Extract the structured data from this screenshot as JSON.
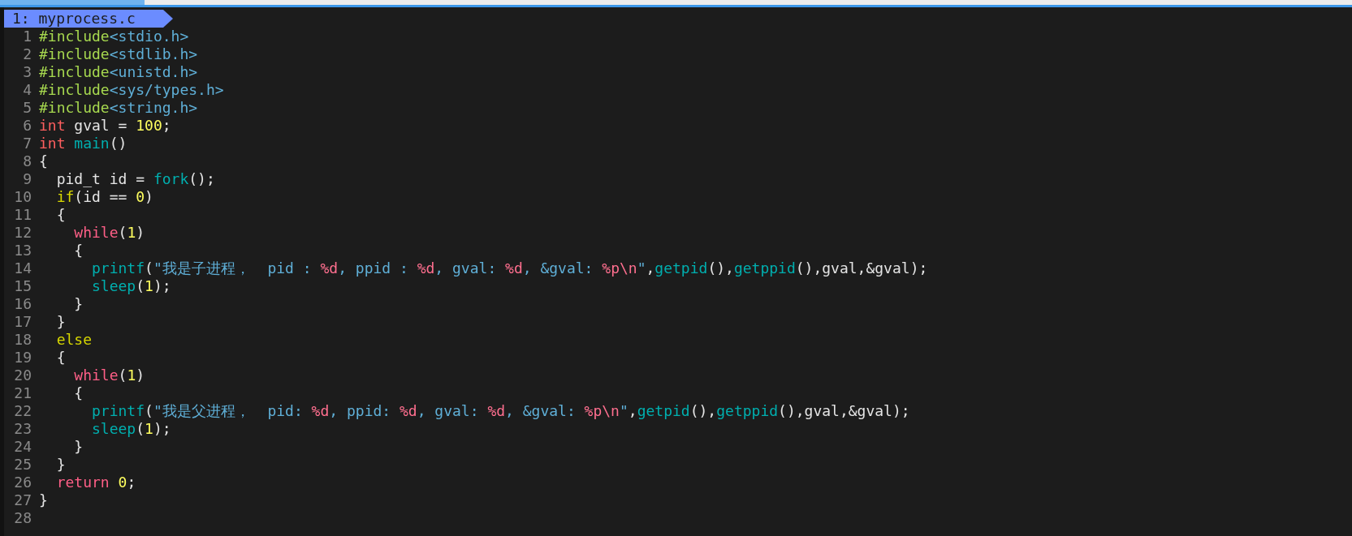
{
  "tab": {
    "label": "1: myprocess.c",
    "selected": true
  },
  "lines": [
    {
      "number": "1",
      "tokens": [
        {
          "kind": "preproc",
          "text": "#include"
        },
        {
          "kind": "path",
          "text": "<stdio.h>"
        }
      ]
    },
    {
      "number": "2",
      "tokens": [
        {
          "kind": "preproc",
          "text": "#include"
        },
        {
          "kind": "path",
          "text": "<stdlib.h>"
        }
      ]
    },
    {
      "number": "3",
      "tokens": [
        {
          "kind": "preproc",
          "text": "#include"
        },
        {
          "kind": "path",
          "text": "<unistd.h>"
        }
      ]
    },
    {
      "number": "4",
      "tokens": [
        {
          "kind": "preproc",
          "text": "#include"
        },
        {
          "kind": "path",
          "text": "<sys/types.h>"
        }
      ]
    },
    {
      "number": "5",
      "tokens": [
        {
          "kind": "preproc",
          "text": "#include"
        },
        {
          "kind": "path",
          "text": "<string.h>"
        }
      ]
    },
    {
      "number": "6",
      "tokens": [
        {
          "kind": "type",
          "text": "int"
        },
        {
          "kind": "plain",
          "text": " gval = "
        },
        {
          "kind": "number",
          "text": "100"
        },
        {
          "kind": "plain",
          "text": ";"
        }
      ]
    },
    {
      "number": "7",
      "tokens": [
        {
          "kind": "type",
          "text": "int "
        },
        {
          "kind": "func",
          "text": "main"
        },
        {
          "kind": "plain",
          "text": "()"
        }
      ]
    },
    {
      "number": "8",
      "tokens": [
        {
          "kind": "plain",
          "text": "{"
        }
      ]
    },
    {
      "number": "9",
      "tokens": [
        {
          "kind": "plain",
          "text": "  pid_t id = "
        },
        {
          "kind": "func",
          "text": "fork"
        },
        {
          "kind": "plain",
          "text": "();"
        }
      ]
    },
    {
      "number": "10",
      "tokens": [
        {
          "kind": "cond",
          "text": "  if"
        },
        {
          "kind": "plain",
          "text": "(id == "
        },
        {
          "kind": "number",
          "text": "0"
        },
        {
          "kind": "plain",
          "text": ")"
        }
      ]
    },
    {
      "number": "11",
      "tokens": [
        {
          "kind": "plain",
          "text": "  {"
        }
      ]
    },
    {
      "number": "12",
      "tokens": [
        {
          "kind": "keyword",
          "text": "    while"
        },
        {
          "kind": "plain",
          "text": "("
        },
        {
          "kind": "number",
          "text": "1"
        },
        {
          "kind": "plain",
          "text": ")"
        }
      ]
    },
    {
      "number": "13",
      "tokens": [
        {
          "kind": "plain",
          "text": "    {"
        }
      ]
    },
    {
      "number": "14",
      "tokens": [
        {
          "kind": "func",
          "text": "      printf"
        },
        {
          "kind": "plain",
          "text": "("
        },
        {
          "kind": "string",
          "text": "\"我是子进程，  pid : "
        },
        {
          "kind": "format",
          "text": "%d"
        },
        {
          "kind": "string",
          "text": ", ppid : "
        },
        {
          "kind": "format",
          "text": "%d"
        },
        {
          "kind": "string",
          "text": ", gval: "
        },
        {
          "kind": "format",
          "text": "%d"
        },
        {
          "kind": "string",
          "text": ", &gval: "
        },
        {
          "kind": "format",
          "text": "%p\\n"
        },
        {
          "kind": "string",
          "text": "\""
        },
        {
          "kind": "plain",
          "text": ","
        },
        {
          "kind": "func",
          "text": "getpid"
        },
        {
          "kind": "plain",
          "text": "(),"
        },
        {
          "kind": "func",
          "text": "getppid"
        },
        {
          "kind": "plain",
          "text": "(),gval,&gval);"
        }
      ]
    },
    {
      "number": "15",
      "tokens": [
        {
          "kind": "func",
          "text": "      sleep"
        },
        {
          "kind": "plain",
          "text": "("
        },
        {
          "kind": "number",
          "text": "1"
        },
        {
          "kind": "plain",
          "text": ");"
        }
      ]
    },
    {
      "number": "16",
      "tokens": [
        {
          "kind": "plain",
          "text": "    }"
        }
      ]
    },
    {
      "number": "17",
      "tokens": [
        {
          "kind": "plain",
          "text": "  }"
        }
      ]
    },
    {
      "number": "18",
      "tokens": [
        {
          "kind": "cond",
          "text": "  else"
        }
      ]
    },
    {
      "number": "19",
      "tokens": [
        {
          "kind": "plain",
          "text": "  {"
        }
      ]
    },
    {
      "number": "20",
      "tokens": [
        {
          "kind": "keyword",
          "text": "    while"
        },
        {
          "kind": "plain",
          "text": "("
        },
        {
          "kind": "number",
          "text": "1"
        },
        {
          "kind": "plain",
          "text": ")"
        }
      ]
    },
    {
      "number": "21",
      "tokens": [
        {
          "kind": "plain",
          "text": "    {"
        }
      ]
    },
    {
      "number": "22",
      "tokens": [
        {
          "kind": "func",
          "text": "      printf"
        },
        {
          "kind": "plain",
          "text": "("
        },
        {
          "kind": "string",
          "text": "\"我是父进程，  pid: "
        },
        {
          "kind": "format",
          "text": "%d"
        },
        {
          "kind": "string",
          "text": ", ppid: "
        },
        {
          "kind": "format",
          "text": "%d"
        },
        {
          "kind": "string",
          "text": ", gval: "
        },
        {
          "kind": "format",
          "text": "%d"
        },
        {
          "kind": "string",
          "text": ", &gval: "
        },
        {
          "kind": "format",
          "text": "%p\\n"
        },
        {
          "kind": "string",
          "text": "\""
        },
        {
          "kind": "plain",
          "text": ","
        },
        {
          "kind": "func",
          "text": "getpid"
        },
        {
          "kind": "plain",
          "text": "(),"
        },
        {
          "kind": "func",
          "text": "getppid"
        },
        {
          "kind": "plain",
          "text": "(),gval,&gval);"
        }
      ]
    },
    {
      "number": "23",
      "tokens": [
        {
          "kind": "func",
          "text": "      sleep"
        },
        {
          "kind": "plain",
          "text": "("
        },
        {
          "kind": "number",
          "text": "1"
        },
        {
          "kind": "plain",
          "text": ");"
        }
      ]
    },
    {
      "number": "24",
      "tokens": [
        {
          "kind": "plain",
          "text": "    }"
        }
      ]
    },
    {
      "number": "25",
      "tokens": [
        {
          "kind": "plain",
          "text": "  }"
        }
      ]
    },
    {
      "number": "26",
      "tokens": [
        {
          "kind": "keyword",
          "text": "  return "
        },
        {
          "kind": "number",
          "text": "0"
        },
        {
          "kind": "plain",
          "text": ";"
        }
      ]
    },
    {
      "number": "27",
      "tokens": [
        {
          "kind": "plain",
          "text": "}"
        }
      ]
    },
    {
      "number": "28"
    }
  ]
}
